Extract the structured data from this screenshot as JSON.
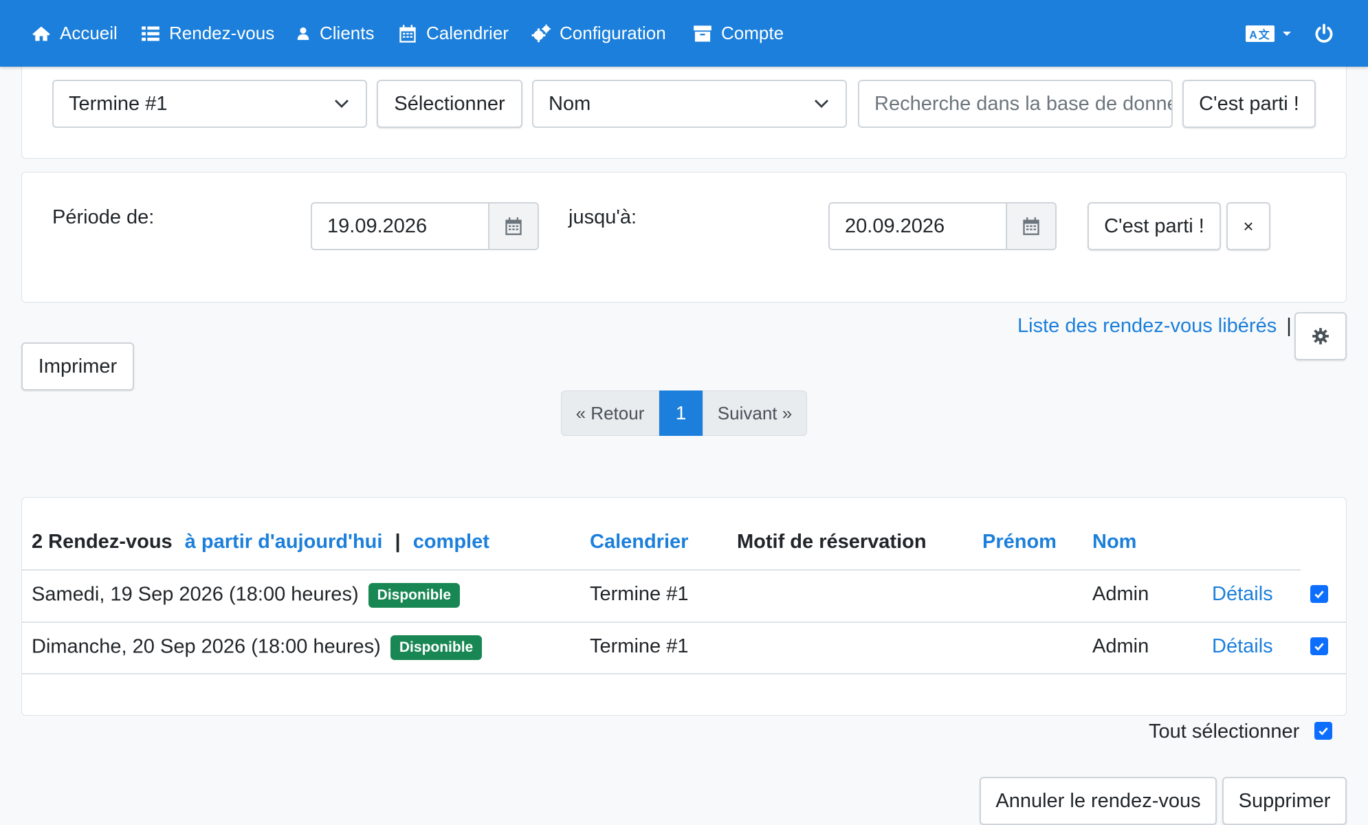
{
  "navbar": {
    "items": [
      {
        "label": "Accueil",
        "icon": "home-icon"
      },
      {
        "label": "Rendez-vous",
        "icon": "list-icon"
      },
      {
        "label": "Clients",
        "icon": "user-icon"
      },
      {
        "label": "Calendrier",
        "icon": "calendar-icon"
      },
      {
        "label": "Configuration",
        "icon": "cogs-icon"
      },
      {
        "label": "Compte",
        "icon": "archive-icon"
      }
    ],
    "language_icon": "translate-icon",
    "logout_icon": "power-icon"
  },
  "search_bar": {
    "calendar_select": "Termine #1",
    "select_button": "Sélectionner",
    "field_select": "Nom",
    "search_placeholder": "Recherche dans la base de données",
    "go_button": "C'est parti !"
  },
  "period": {
    "from_label": "Période de:",
    "from_value": "19.09.2026",
    "to_label": "jusqu'à:",
    "to_value": "20.09.2026",
    "go_button": "C'est parti !",
    "clear_button": "×"
  },
  "toolbar": {
    "released_link": "Liste des rendez-vous libérés",
    "separator": "|",
    "print_button": "Imprimer"
  },
  "pagination": {
    "prev": "« Retour",
    "current": "1",
    "next": "Suivant »"
  },
  "table": {
    "count_label": "2 Rendez-vous",
    "filter_today": "à partir d'aujourd'hui",
    "filter_sep": "|",
    "filter_all": "complet",
    "headers": {
      "calendar": "Calendrier",
      "reason": "Motif de réservation",
      "firstname": "Prénom",
      "lastname": "Nom"
    },
    "rows": [
      {
        "date": "Samedi, 19 Sep 2026 (18:00 heures)",
        "status": "Disponible",
        "calendar": "Termine #1",
        "reason": "",
        "firstname": "",
        "lastname": "Admin",
        "details": "Détails",
        "checked": true
      },
      {
        "date": "Dimanche, 20 Sep 2026 (18:00 heures)",
        "status": "Disponible",
        "calendar": "Termine #1",
        "reason": "",
        "firstname": "",
        "lastname": "Admin",
        "details": "Détails",
        "checked": true
      }
    ]
  },
  "footer": {
    "select_all_label": "Tout sélectionner",
    "select_all_checked": true,
    "cancel_button": "Annuler le rendez-vous",
    "delete_button": "Supprimer"
  },
  "colors": {
    "primary": "#1b7fdb",
    "success_badge": "#198754",
    "checkbox": "#0d6efd"
  }
}
